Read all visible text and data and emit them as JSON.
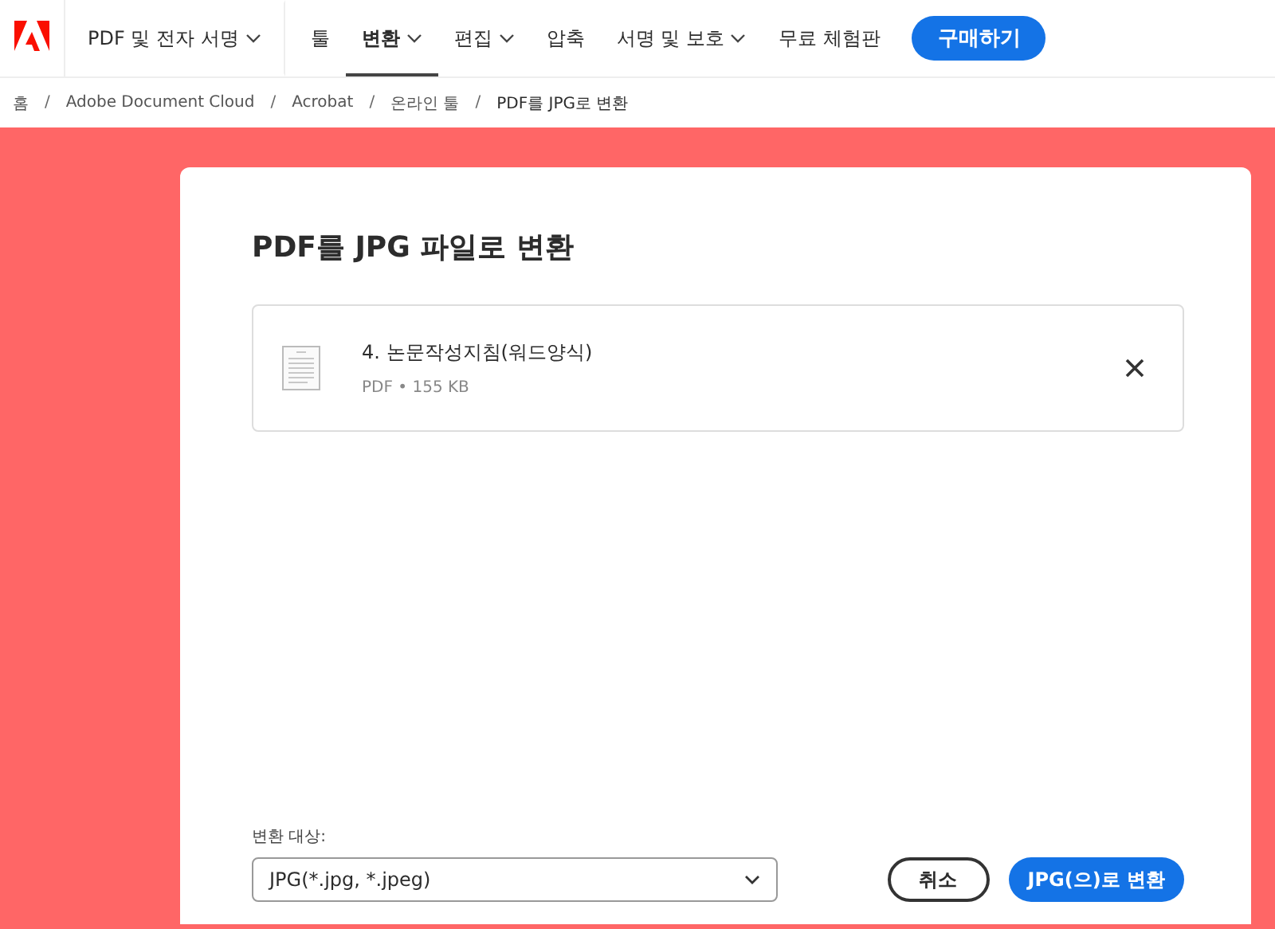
{
  "nav": {
    "items": [
      {
        "label": "PDF 및 전자 서명",
        "has_menu": true,
        "selected": false
      },
      {
        "label": "툴",
        "has_menu": false,
        "selected": false
      },
      {
        "label": "변환",
        "has_menu": true,
        "selected": true
      },
      {
        "label": "편집",
        "has_menu": true,
        "selected": false
      },
      {
        "label": "압축",
        "has_menu": false,
        "selected": false
      },
      {
        "label": "서명 및 보호",
        "has_menu": true,
        "selected": false
      },
      {
        "label": "무료 체험판",
        "has_menu": false,
        "selected": false
      }
    ],
    "buy_button": "구매하기"
  },
  "breadcrumb_separator": "/",
  "breadcrumb": [
    "홈",
    "Adobe Document Cloud",
    "Acrobat",
    "온라인 툴",
    "PDF를 JPG로 변환"
  ],
  "card": {
    "title": "PDF를 JPG 파일로 변환",
    "file": {
      "name": "4. 논문작성지침(워드양식)",
      "meta": "PDF • 155 KB"
    },
    "format_label": "변환 대상:",
    "format_value": "JPG(*.jpg, *.jpeg)",
    "cancel_button": "취소",
    "convert_button": "JPG(으)로 변환"
  }
}
